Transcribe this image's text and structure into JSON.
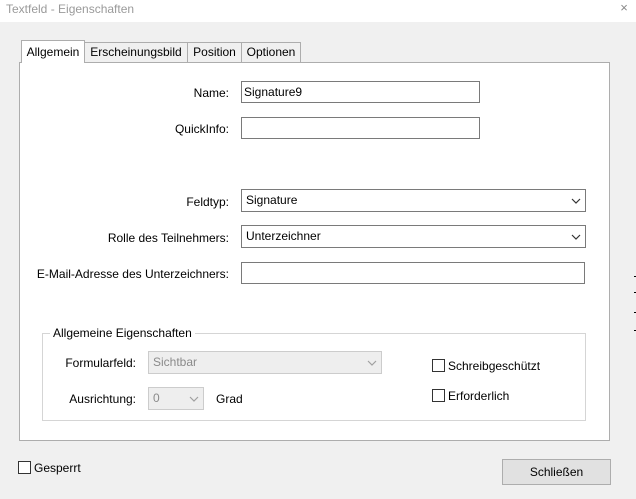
{
  "window": {
    "title": "Textfeld - Eigenschaften",
    "close_glyph": "×"
  },
  "tabs": [
    "Allgemein",
    "Erscheinungsbild",
    "Position",
    "Optionen"
  ],
  "form": {
    "name_label": "Name:",
    "name_value": "Signature9",
    "quickinfo_label": "QuickInfo:",
    "quickinfo_value": "",
    "feldtyp_label": "Feldtyp:",
    "feldtyp_value": "Signature",
    "rolle_label": "Rolle des Teilnehmers:",
    "rolle_value": "Unterzeichner",
    "email_label": "E-Mail-Adresse des Unterzeichners:",
    "email_value": ""
  },
  "general_properties": {
    "legend": "Allgemeine Eigenschaften",
    "formularfeld_label": "Formularfeld:",
    "formularfeld_value": "Sichtbar",
    "ausrichtung_label": "Ausrichtung:",
    "ausrichtung_value": "0",
    "grad_label": "Grad",
    "schreibgeschuetzt_label": "Schreibgeschützt",
    "schreibgeschuetzt_checked": false,
    "erforderlich_label": "Erforderlich",
    "erforderlich_checked": false
  },
  "footer": {
    "gesperrt_label": "Gesperrt",
    "gesperrt_checked": false,
    "close_button": "Schließen"
  },
  "icons": {
    "dropdown": "chevron-down-icon",
    "close": "close-icon"
  }
}
